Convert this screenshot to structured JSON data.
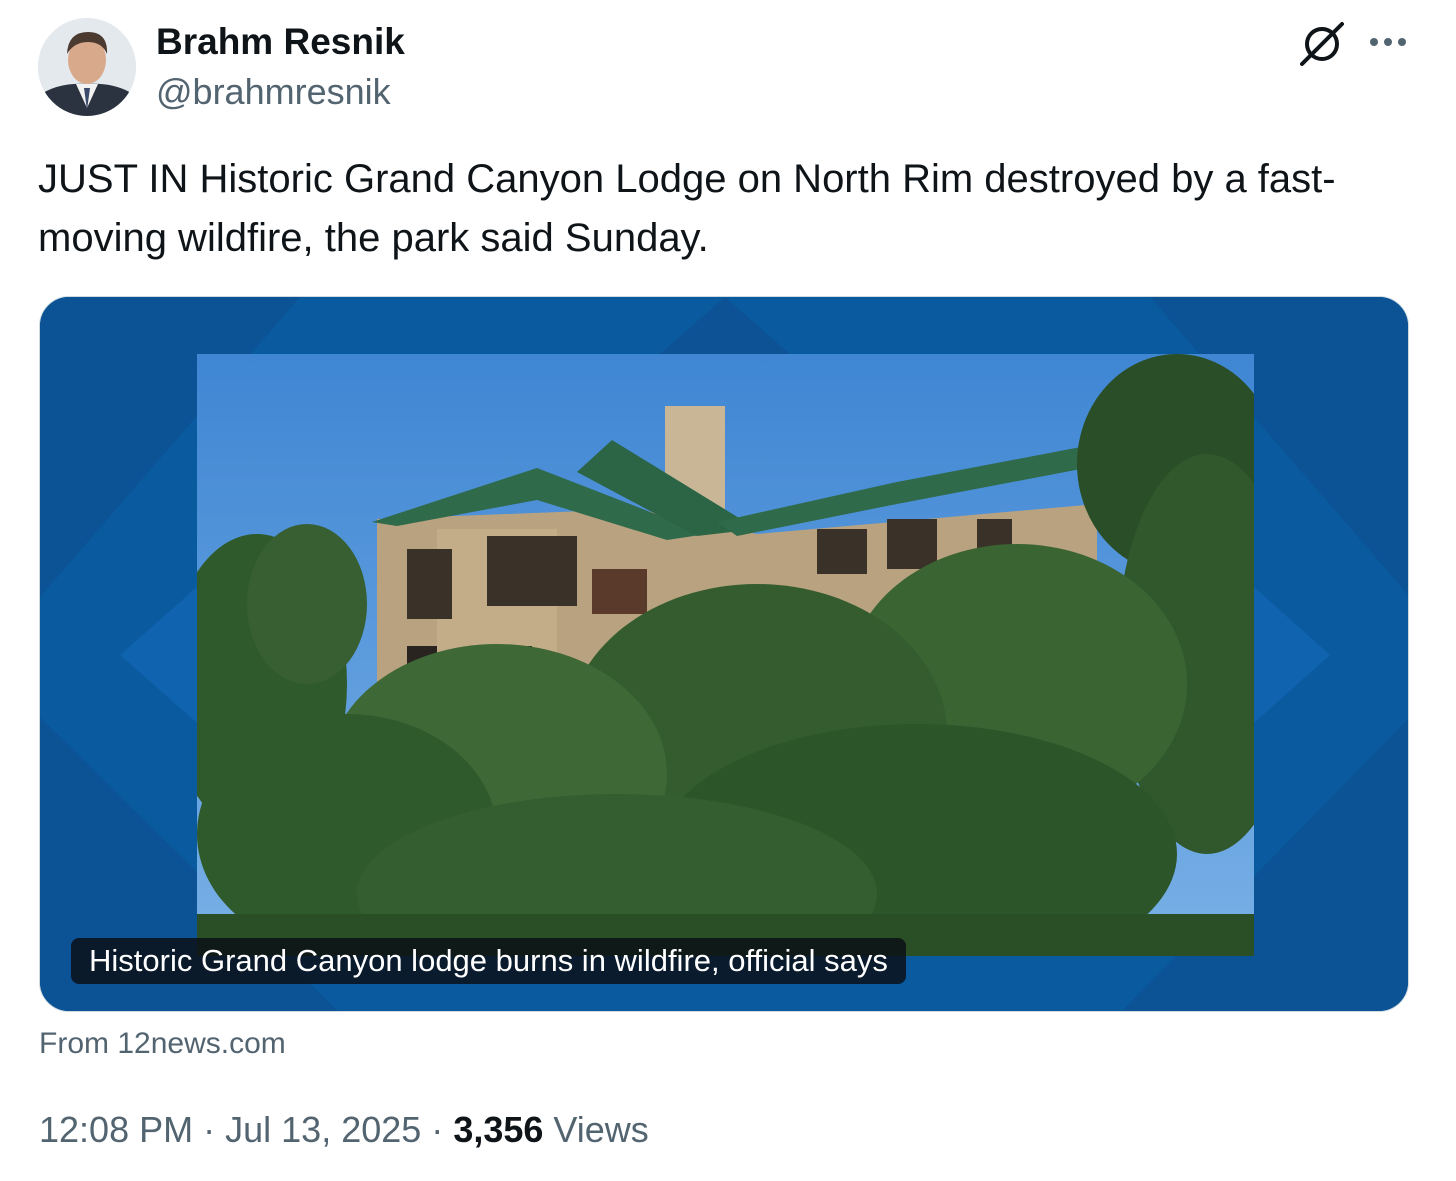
{
  "author": {
    "display_name": "Brahm Resnik",
    "handle": "@brahmresnik"
  },
  "header_icons": {
    "grok": "grok-slash-icon",
    "more": "more-horizontal-icon"
  },
  "tweet": {
    "text": "JUST IN Historic Grand Canyon Lodge on North Rim destroyed by a fast-moving wildfire, the park said Sunday."
  },
  "link_card": {
    "caption": "Historic Grand Canyon lodge burns in wildfire, official says",
    "source": "From 12news.com",
    "background_color": "#0a5aa0"
  },
  "meta": {
    "time": "12:08 PM",
    "separator": "·",
    "date": "Jul 13, 2025",
    "views_count": "3,356",
    "views_label": "Views"
  },
  "colors": {
    "text_primary": "#0f1419",
    "text_secondary": "#536471",
    "roof_green": "#2f6a4a",
    "sky": "#4a8fd6"
  }
}
